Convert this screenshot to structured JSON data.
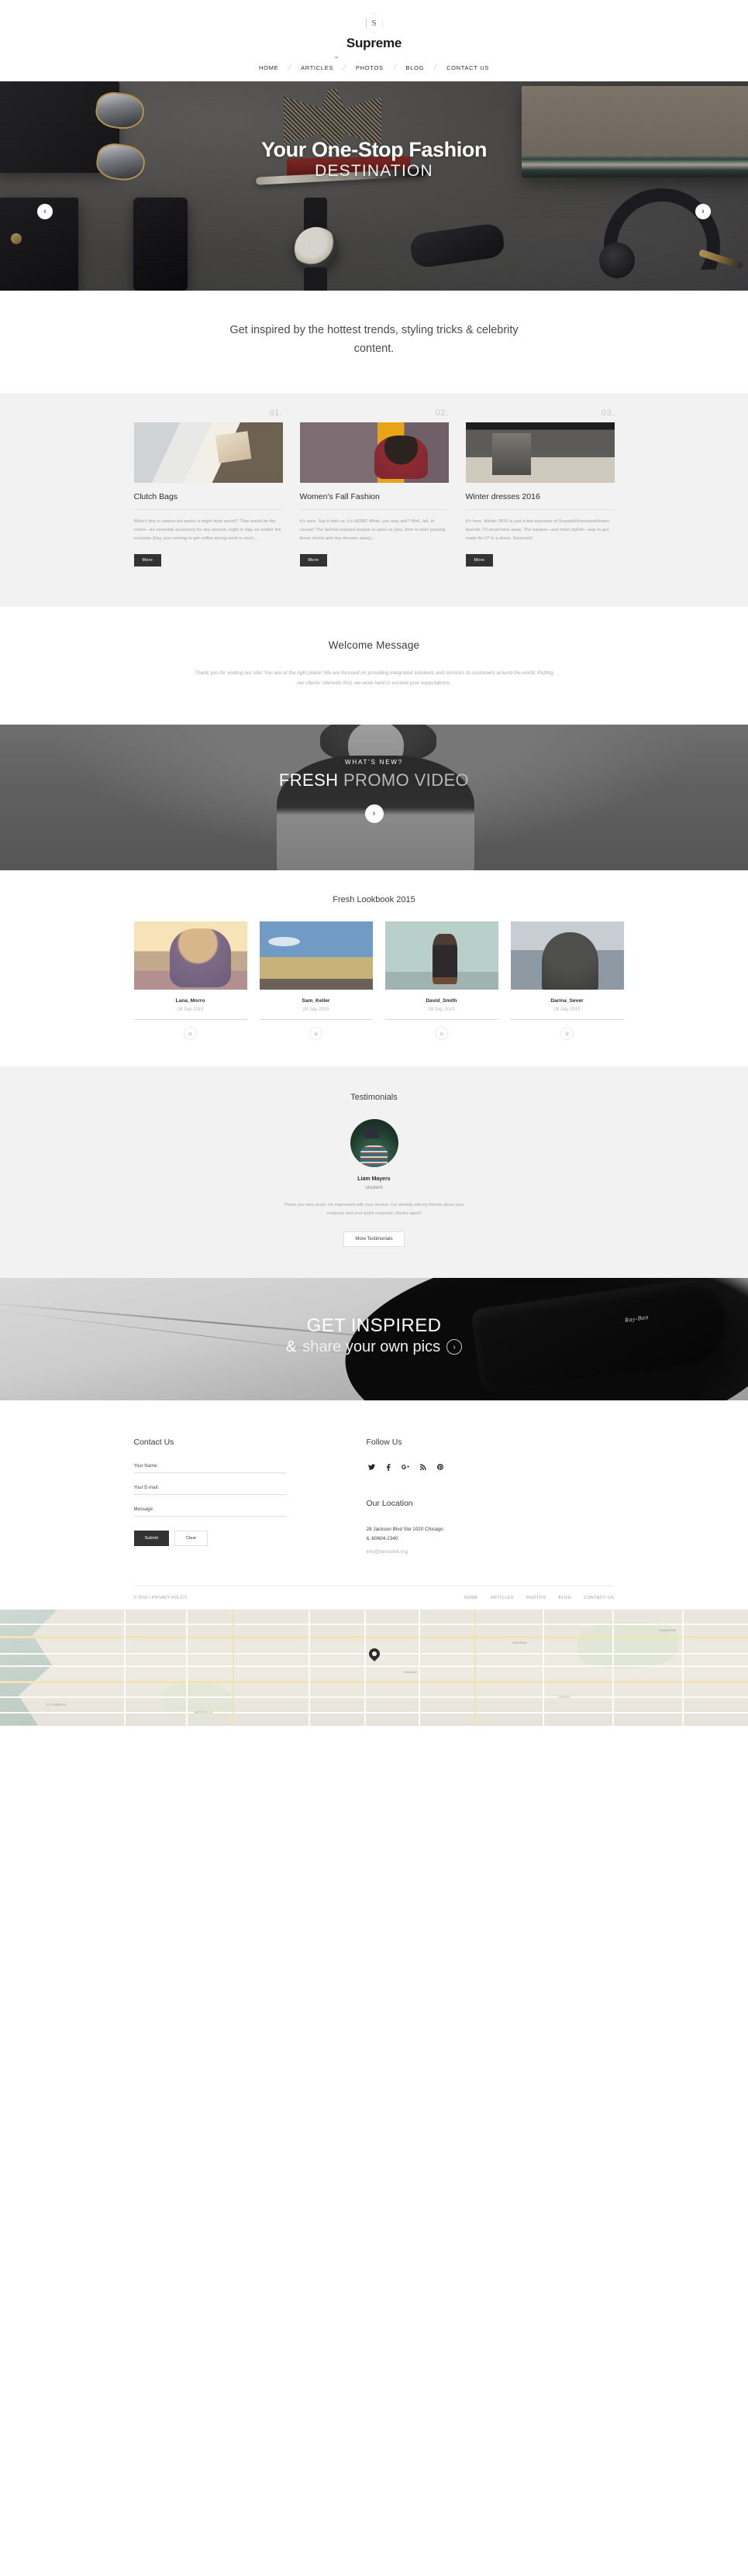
{
  "header": {
    "logo_glyph": "S",
    "brand": "Supreme",
    "nav": [
      {
        "label": "HOME",
        "active": true
      },
      {
        "label": "ARTICLES",
        "active": false
      },
      {
        "label": "PHOTOS",
        "active": false
      },
      {
        "label": "BLOG",
        "active": false
      },
      {
        "label": "CONTACT US",
        "active": false
      }
    ]
  },
  "hero": {
    "title": "Your One-Stop Fashion",
    "subtitle": "DESTINATION",
    "prev_icon": "chevron-left",
    "next_icon": "chevron-right"
  },
  "intro": {
    "text": "Get inspired by the hottest trends, styling tricks & celebrity content."
  },
  "posts": {
    "button_label": "More",
    "items": [
      {
        "number": "01.",
        "title": "Clutch Bags",
        "body": "What's tiny in stature but packs a might style punch? That would be the clutch—an essential accessory for any woman, night or day, no matter the occasion (hey, just running to get coffee during work is one!)..."
      },
      {
        "number": "02.",
        "title": "Women's Fall Fashion",
        "body": "It's here. Say it with us, it's HERE! What, you may ask? Well, fall, of course! The fashion-packed season is upon us (yes, time to start packing those shorts and tiny dresses away)..."
      },
      {
        "number": "03.",
        "title": "Winter dresses 2016",
        "body": "It's here. Winter 2016 is just a few episodes of Scandal/Homeland/insert-favorite-TV-show-here away. The easiest—and most stylish—way to get ready for it? In a dress. Seriously!"
      }
    ]
  },
  "welcome": {
    "title": "Welcome Message",
    "text": "Thank you for visiting our site! You are at the right place! We are focused on providing integrated solutions and services to customers around the world. Putting our clients' interests first, we work hard to exceed your expectations."
  },
  "video": {
    "kicker": "WHAT'S NEW?",
    "title_strong": "FRESH",
    "title_light": "PROMO VIDEO",
    "play_icon": "play-chevron"
  },
  "lookbook": {
    "title": "Fresh Lookbook 2015",
    "search_icon": "magnifier-icon",
    "eye_icon": "eye-icon",
    "items": [
      {
        "name": "Lana_Morro",
        "date": "28 Sep 2015"
      },
      {
        "name": "Sam_Keller",
        "date": "28 Sep 2015"
      },
      {
        "name": "David_Smith",
        "date": "28 Sep 2015"
      },
      {
        "name": "Darina_Sever",
        "date": "28 Sep 2015"
      }
    ]
  },
  "testimonials": {
    "title": "Testimonials",
    "name": "Liam Mayers",
    "role": "student",
    "quote": "Thank you very much. I'm impressed with your service. I've already told my friends about your company and your quick response, thanks again!",
    "button_label": "More Testimonials"
  },
  "inspire": {
    "line1": "GET INSPIRED",
    "amp": "&",
    "line2": "share your own pics",
    "go_icon": "chevron-right",
    "brand_mark": "Ray-Ban"
  },
  "footer": {
    "contact_title": "Contact Us",
    "fields": [
      {
        "label": "Your Name:",
        "value": "",
        "placeholder": ""
      },
      {
        "label": "Your E-mail:",
        "value": "",
        "placeholder": ""
      },
      {
        "label": "Message:",
        "value": "",
        "placeholder": ""
      }
    ],
    "submit_label": "Submit",
    "clear_label": "Clear",
    "follow_title": "Follow Us",
    "socials": [
      {
        "name": "twitter-icon",
        "glyph": "t"
      },
      {
        "name": "facebook-icon",
        "glyph": "f"
      },
      {
        "name": "google-plus-icon",
        "glyph": "g"
      },
      {
        "name": "rss-icon",
        "glyph": "◔"
      },
      {
        "name": "pinterest-icon",
        "glyph": "ⓟ"
      }
    ],
    "location_title": "Our Location",
    "address_line1": "28 Jackson Blvd Ste 1020 Chicago",
    "address_line2": "IL 60604-2340",
    "email": "info@demolink.org",
    "copyright": "© 2016 •",
    "privacy": "PRIVACY POLICY",
    "nav": [
      "HOME",
      "ARTICLES",
      "PHOTOS",
      "BLOG",
      "CONTACT US"
    ]
  },
  "map": {
    "pin_icon": "map-pin-icon",
    "labels": [
      "ST CHARLES",
      "NAPERVILLE",
      "CHICAGO",
      "OAK PARK",
      "CICERO",
      "EVANSTON"
    ]
  },
  "colors": {
    "accent_dark": "#333333",
    "page_bg": "#ffffff",
    "section_bg": "#f2f2f2",
    "muted_text": "#a3a3a3"
  }
}
